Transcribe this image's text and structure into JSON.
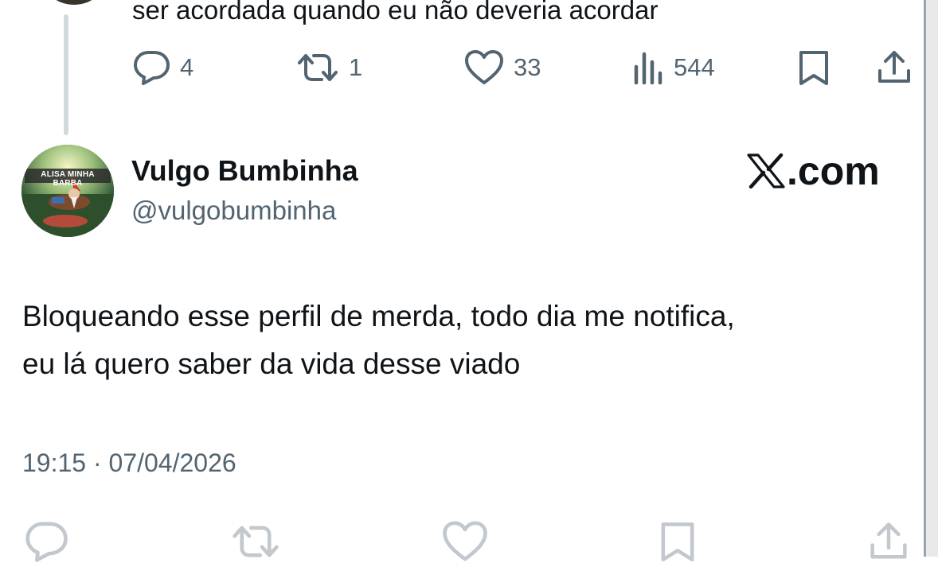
{
  "previous_tweet": {
    "text": "ser acordada quando eu não deveria acordar",
    "actions": {
      "replies": "4",
      "retweets": "1",
      "likes": "33",
      "views": "544"
    }
  },
  "tweet": {
    "avatar_banner_text": "ALISA MINHA BARBA",
    "display_name": "Vulgo Bumbinha",
    "handle": "@vulgobumbinha",
    "brand_suffix": ".com",
    "body_line1": "Bloqueando esse perfil de merda, todo dia me notifica,",
    "body_line2": "eu lá quero saber da vida desse viado",
    "timestamp": "19:15 · 07/04/2026"
  },
  "icons": [
    "reply-icon",
    "retweet-icon",
    "like-icon",
    "views-icon",
    "bookmark-icon",
    "share-icon",
    "x-logo-icon"
  ],
  "colors": {
    "text": "#0f1419",
    "secondary": "#536471",
    "thread_line": "#cfd9de"
  }
}
